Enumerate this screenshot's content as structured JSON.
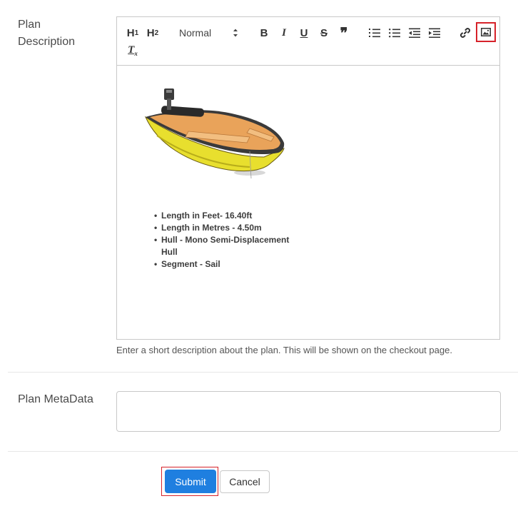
{
  "plan_description": {
    "label_line1": "Plan",
    "label_line2": "Description",
    "help_text": "Enter a short description about the plan. This will be shown on the checkout page.",
    "toolbar": {
      "h1_label": "H",
      "h1_sub": "1",
      "h2_label": "H",
      "h2_sub": "2",
      "format_select_value": "Normal",
      "bold_label": "B",
      "italic_label": "I",
      "underline_label": "U",
      "strike_label": "S",
      "quote_label": "❞",
      "clean_label": "T",
      "clean_sub": "x"
    },
    "content": {
      "bullets": [
        "Length in Feet- 16.40ft",
        "Length in Metres - 4.50m",
        "Hull - Mono Semi-Displacement Hull",
        "Segment - Sail"
      ]
    }
  },
  "plan_metadata": {
    "label": "Plan MetaData",
    "value": ""
  },
  "actions": {
    "submit_label": "Submit",
    "cancel_label": "Cancel"
  },
  "colors": {
    "primary_button": "#1f7fe0",
    "highlight_outline": "#d6222a"
  }
}
